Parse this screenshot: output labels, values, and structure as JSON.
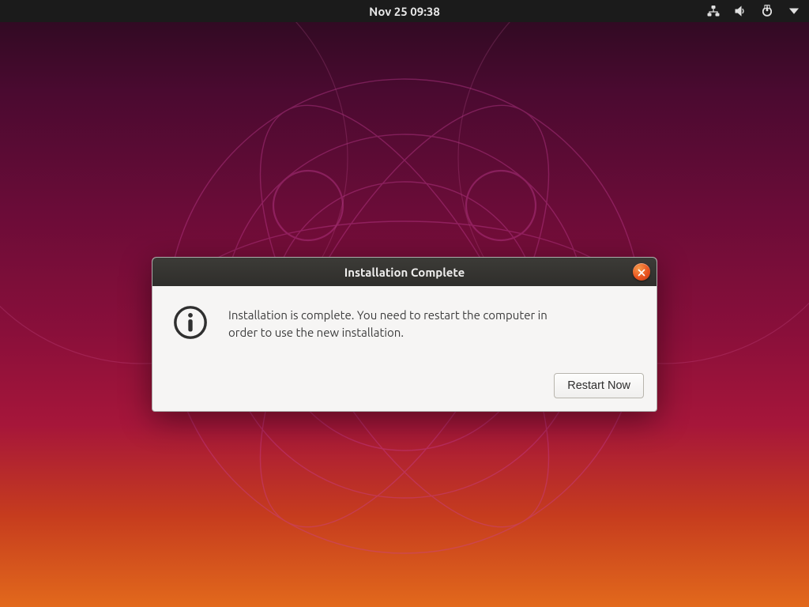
{
  "topbar": {
    "clock": "Nov 25  09:38"
  },
  "dialog": {
    "title": "Installation Complete",
    "message": "Installation is complete. You need to restart the computer in order to use the new installation.",
    "restart_label": "Restart Now"
  },
  "colors": {
    "accent_close": "#e95420"
  }
}
